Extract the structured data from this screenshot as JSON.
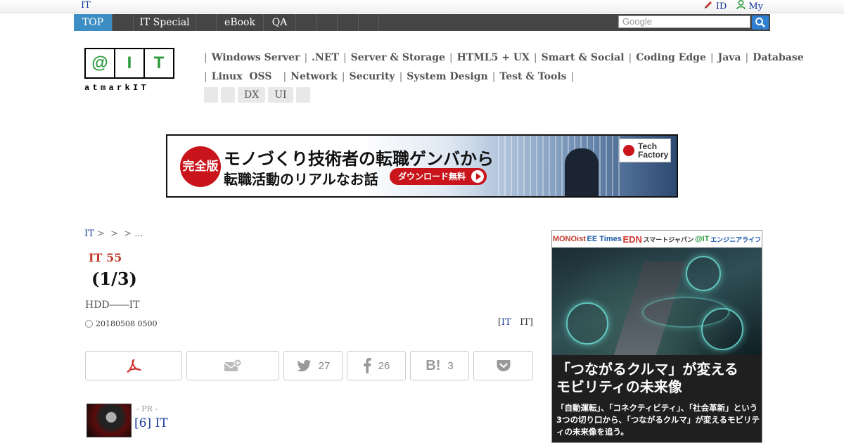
{
  "topbar": {
    "site_label": "IT",
    "id_label": "ID",
    "my_label": "My"
  },
  "nav": {
    "tabs": [
      {
        "label": "TOP",
        "active": true
      },
      {
        "label": ""
      },
      {
        "label": "IT Special"
      },
      {
        "label": ""
      },
      {
        "label": "eBook"
      },
      {
        "label": "QA"
      },
      {
        "label": ""
      },
      {
        "label": ""
      },
      {
        "label": ""
      },
      {
        "label": ""
      }
    ],
    "search_placeholder": "Google"
  },
  "logo": {
    "cells": [
      "@",
      "I",
      "T"
    ],
    "sub": "atmarkIT"
  },
  "categories": {
    "row1": [
      "Windows Server",
      ".NET",
      "Server & Storage",
      "HTML5 + UX",
      "Smart & Social",
      "Coding Edge",
      "Java",
      "Database"
    ],
    "row2": [
      "Linux  OSS",
      "Network",
      "Security",
      "System Design",
      "Test & Tools"
    ]
  },
  "tags": [
    "",
    "",
    "DX",
    "UI",
    ""
  ],
  "banner": {
    "stamp": "完全版",
    "line1": "モノづくり技術者の転職ゲンバから",
    "line2": "転職活動のリアルなお話",
    "button": "ダウンロード無料",
    "badge": "Tech Factory"
  },
  "article": {
    "breadcrumb_home": "IT",
    "breadcrumb_rest": " >  >  > ...",
    "kicker": "IT 55",
    "title": "(1/3)",
    "lead": "HDD――IT",
    "date": "20180508 0500",
    "byline_open": "[",
    "byline_link": "IT",
    "byline_close": "   IT]"
  },
  "share": {
    "twitter_count": "27",
    "facebook_count": "26",
    "hatena_count": "3"
  },
  "pr": {
    "label": "- PR -",
    "title": "[6] IT"
  },
  "side_ad": {
    "logos": [
      "MONOist",
      "EE Times",
      "EDN",
      "スマートジャパン",
      "@IT",
      "エンジニアライフ"
    ],
    "headline1": "「つながるクルマ」が変える",
    "headline2": "モビリティの未来像",
    "body": "「自動運転」、「コネクティビティ」、「社会革新」という3つの切り口から、「つながるクルマ」が変えるモビリティの未来像を追う。"
  },
  "colors": {
    "nav_bg": "#454545",
    "nav_active": "#3c8ec4",
    "link": "#1a3a9a",
    "kicker": "#c0392b",
    "logo_green": "#2a9a3a"
  }
}
